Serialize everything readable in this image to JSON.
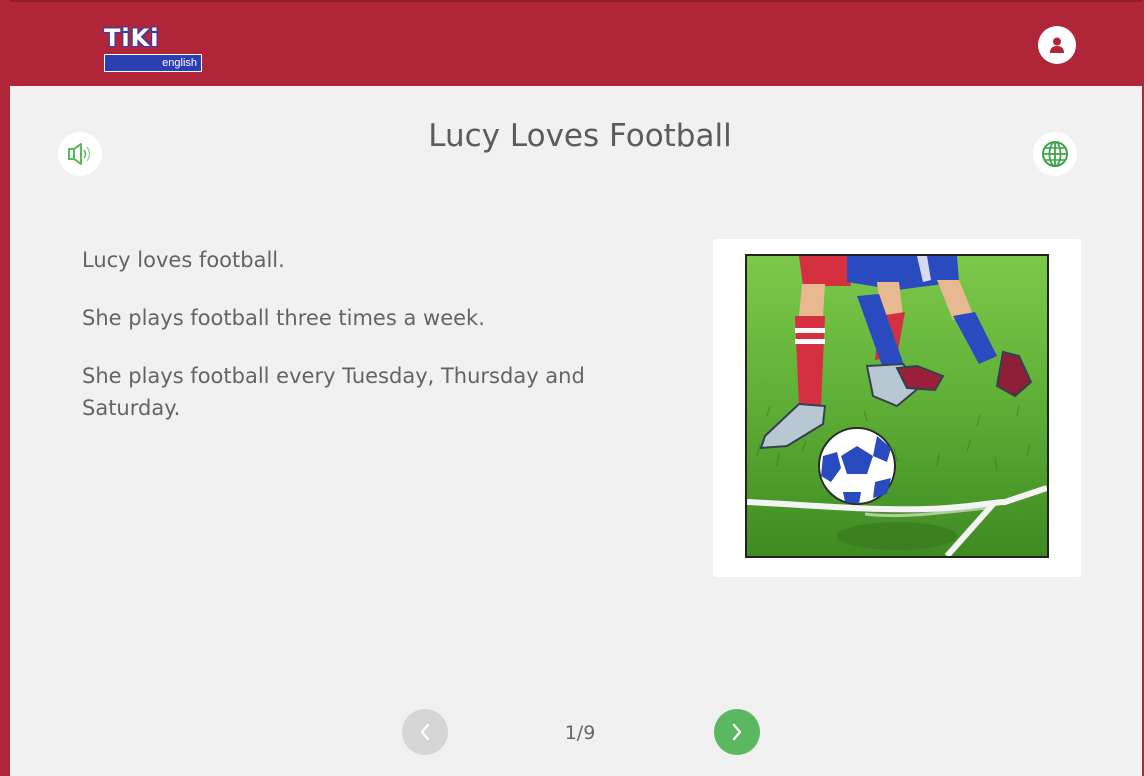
{
  "header": {
    "logo_text": "TiKi",
    "logo_subtext": "english"
  },
  "story": {
    "title": "Lucy Loves Football",
    "paragraphs": [
      "Lucy loves football.",
      "She plays football three times a week.",
      "She plays football every Tuesday, Thursday and Saturday."
    ]
  },
  "pagination": {
    "current": 1,
    "total": 9,
    "label": "1/9"
  },
  "icons": {
    "sound": "speaker-icon",
    "translate": "globe-icon",
    "user": "user-icon",
    "prev": "chevron-left-icon",
    "next": "chevron-right-icon"
  },
  "colors": {
    "brand_red": "#b12538",
    "logo_blue": "#2b3fb3",
    "accent_green": "#5cb860",
    "disabled_gray": "#d6d6d6"
  }
}
